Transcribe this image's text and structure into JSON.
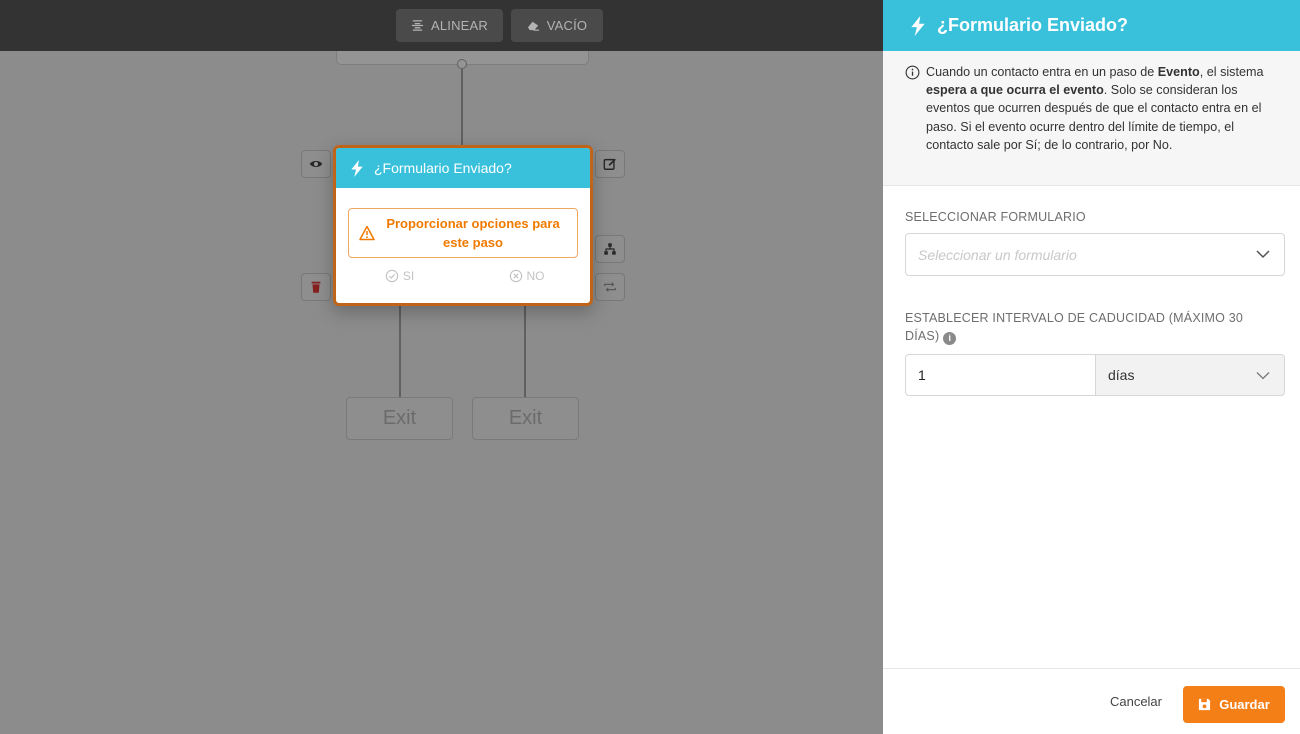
{
  "toolbar": {
    "align_label": "ALINEAR",
    "empty_label": "VACÍO"
  },
  "canvas": {
    "node": {
      "title": "¿Formulario Enviado?",
      "warning": "Proporcionar opciones para este paso",
      "branch_yes": "SI",
      "branch_no": "NO"
    },
    "exits": [
      "Exit",
      "Exit"
    ]
  },
  "panel": {
    "title": "¿Formulario Enviado?",
    "info": {
      "t1": "Cuando un contacto entra en un paso de ",
      "b1": "Evento",
      "t2": ", el sistema ",
      "b2": "espera a que ocurra el evento",
      "t3": ". Solo se consideran los eventos que ocurren después de que el contacto entra en el paso. Si el evento ocurre dentro del límite de tiempo, el contacto sale por Sí; de lo contrario, por No."
    },
    "form_label": "SELECCIONAR FORMULARIO",
    "form_placeholder": "Seleccionar un formulario",
    "expiry_label": "ESTABLECER INTERVALO DE CADUCIDAD (MÁXIMO 30 DÍAS)",
    "expiry_value": "1",
    "expiry_unit": "días",
    "cancel_label": "Cancelar",
    "save_label": "Guardar"
  },
  "colors": {
    "accent": "#39c1dc",
    "warning": "#f07a00",
    "save": "#f57f17",
    "node_border": "#c0641a",
    "delete": "#e53935"
  }
}
